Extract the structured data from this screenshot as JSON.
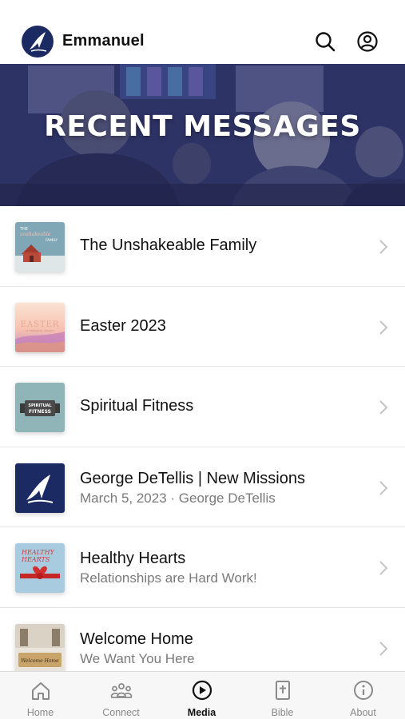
{
  "header": {
    "brand": "Emmanuel",
    "search_icon": "search-icon",
    "account_icon": "account-icon"
  },
  "hero": {
    "title": "RECENT MESSAGES"
  },
  "messages": [
    {
      "title": "The Unshakeable Family",
      "subtitle": ""
    },
    {
      "title": "Easter 2023",
      "subtitle": ""
    },
    {
      "title": "Spiritual Fitness",
      "subtitle": ""
    },
    {
      "title": "George DeTellis | New Missions",
      "subtitle": "March 5, 2023 · George DeTellis"
    },
    {
      "title": "Healthy Hearts",
      "subtitle": "Relationships are Hard Work!"
    },
    {
      "title": "Welcome Home",
      "subtitle": "We Want You Here"
    }
  ],
  "thumbnail_text": {
    "unshakeable": "THE unshakeable FAMILY",
    "easter": "EASTER",
    "easter_sub": "AT EMMANUEL CHURCH",
    "fitness_top": "SPIRITUAL",
    "fitness_bottom": "FITNESS",
    "hearts": "HEALTHY HEARTS",
    "welcome": "Welcome Home"
  },
  "tabs": [
    {
      "label": "Home",
      "icon": "home-icon",
      "active": false
    },
    {
      "label": "Connect",
      "icon": "people-icon",
      "active": false
    },
    {
      "label": "Media",
      "icon": "play-icon",
      "active": true
    },
    {
      "label": "Bible",
      "icon": "bible-icon",
      "active": false
    },
    {
      "label": "About",
      "icon": "info-icon",
      "active": false
    }
  ],
  "colors": {
    "brand_navy": "#1c2a63",
    "hero_overlay": "#2c3060",
    "active_tab": "#111111",
    "inactive_tab": "#8a8a8a"
  }
}
